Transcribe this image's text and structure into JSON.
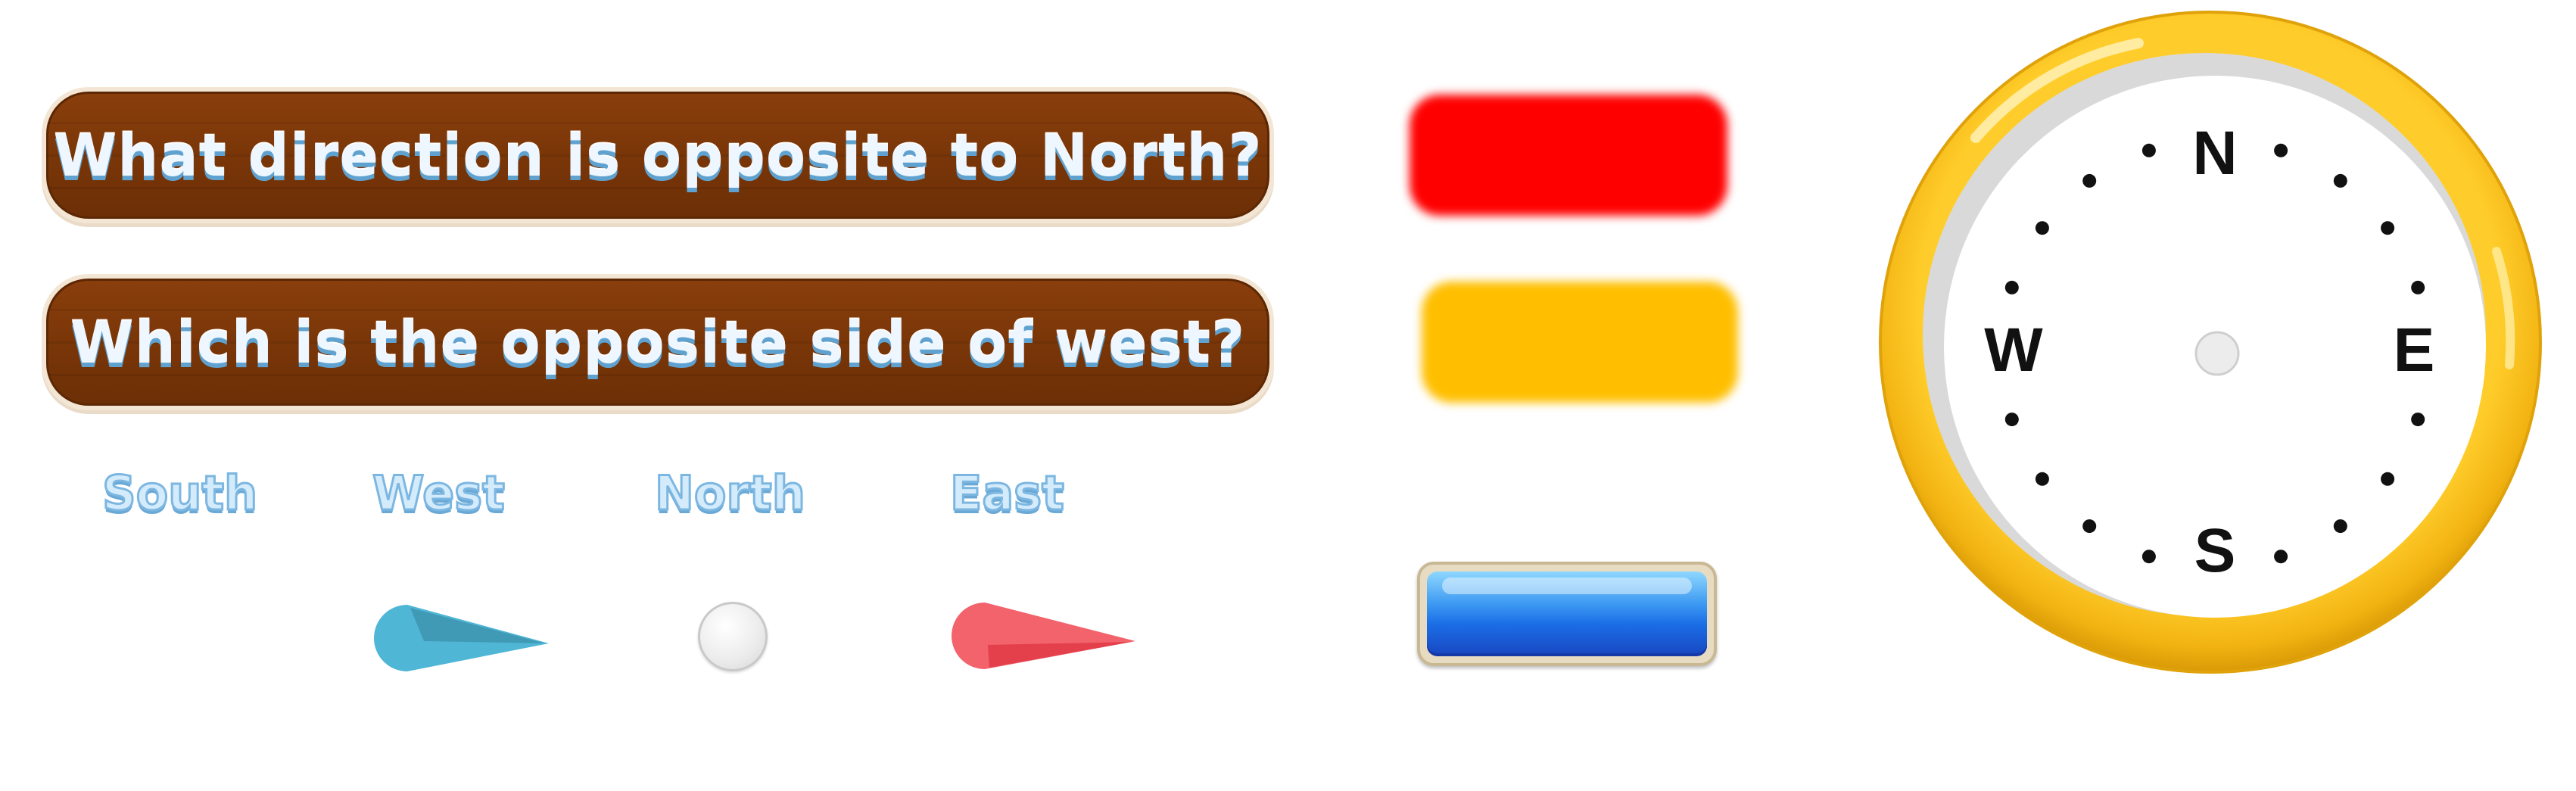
{
  "questions": [
    {
      "text": "What direction is opposite to North?"
    },
    {
      "text": "Which is the opposite side of west?"
    }
  ],
  "direction_options": [
    "South",
    "West",
    "North",
    "East"
  ],
  "compass": {
    "north": "N",
    "east": "E",
    "south": "S",
    "west": "W"
  },
  "colors": {
    "question_wood": "#7a3608",
    "answer_red": "#ff0000",
    "answer_yellow": "#ffbf00",
    "button_blue": "#1b6ee6",
    "needle_blue": "#4fb6d6",
    "needle_red": "#f2636b",
    "compass_ring": "#f2b312"
  }
}
